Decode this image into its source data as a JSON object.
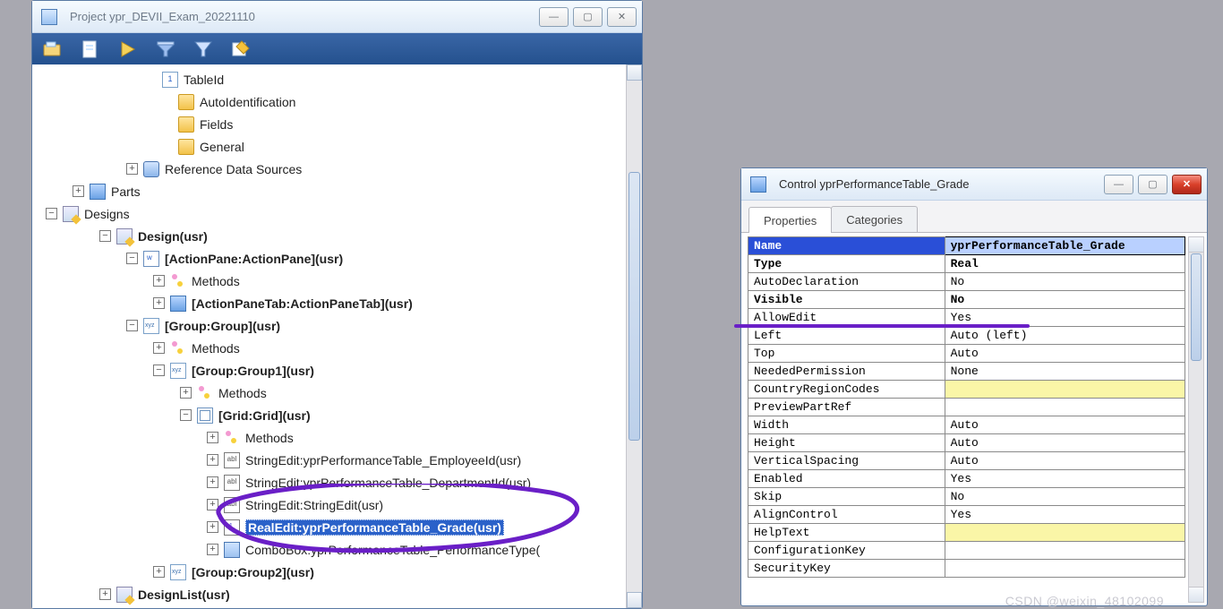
{
  "project": {
    "title": "Project ypr_DEVII_Exam_20221110",
    "nodes": {
      "tableId": "TableId",
      "autoId": "AutoIdentification",
      "fields": "Fields",
      "general": "General",
      "refDS": "Reference Data Sources",
      "parts": "Parts",
      "designs": "Designs",
      "design": "Design(usr)",
      "actionPane": "[ActionPane:ActionPane](usr)",
      "methods": "Methods",
      "actionPaneTab": "[ActionPaneTab:ActionPaneTab](usr)",
      "group": "[Group:Group](usr)",
      "group1": "[Group:Group1](usr)",
      "grid": "[Grid:Grid](usr)",
      "se_emp": "StringEdit:yprPerformanceTable_EmployeeId(usr)",
      "se_dept": "StringEdit:yprPerformanceTable_DepartmentId(usr)",
      "se_str": "StringEdit:StringEdit(usr)",
      "re_grade": "RealEdit:yprPerformanceTable_Grade(usr)",
      "cb_perf": "ComboBox:yprPerformanceTable_PerformanceType(",
      "group2": "[Group:Group2](usr)",
      "designList": "DesignList(usr)"
    }
  },
  "control": {
    "title": "Control yprPerformanceTable_Grade",
    "tabs": {
      "properties": "Properties",
      "categories": "Categories"
    },
    "rows": [
      {
        "name": "Name",
        "value": "yprPerformanceTable_Grade",
        "bold": true,
        "sel": true
      },
      {
        "name": "Type",
        "value": "Real",
        "bold": true
      },
      {
        "name": "AutoDeclaration",
        "value": "No"
      },
      {
        "name": "Visible",
        "value": "No",
        "bold": true
      },
      {
        "name": "AllowEdit",
        "value": "Yes"
      },
      {
        "name": "Left",
        "value": "Auto (left)"
      },
      {
        "name": "Top",
        "value": "Auto"
      },
      {
        "name": "NeededPermission",
        "value": "None"
      },
      {
        "name": "CountryRegionCodes",
        "value": "",
        "yellow": true
      },
      {
        "name": "PreviewPartRef",
        "value": ""
      },
      {
        "name": "Width",
        "value": "Auto"
      },
      {
        "name": "Height",
        "value": "Auto"
      },
      {
        "name": "VerticalSpacing",
        "value": "Auto"
      },
      {
        "name": "Enabled",
        "value": "Yes"
      },
      {
        "name": "Skip",
        "value": "No"
      },
      {
        "name": "AlignControl",
        "value": "Yes"
      },
      {
        "name": "HelpText",
        "value": "",
        "yellow": true
      },
      {
        "name": "ConfigurationKey",
        "value": ""
      },
      {
        "name": "SecurityKey",
        "value": ""
      }
    ]
  },
  "watermark": "CSDN @weixin_48102099"
}
